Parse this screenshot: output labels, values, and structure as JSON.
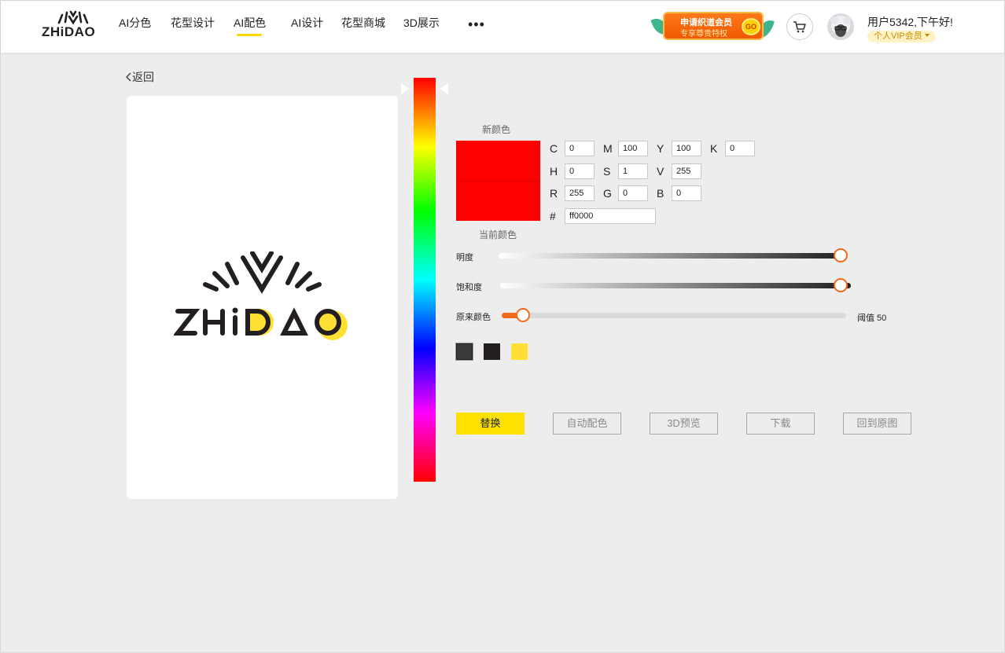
{
  "header": {
    "logo_text": "ZHiDAO",
    "nav": [
      {
        "label": "AI分色",
        "name": "nav-ai-separation"
      },
      {
        "label": "花型设计",
        "name": "nav-pattern-design"
      },
      {
        "label": "AI配色",
        "name": "nav-ai-coloring",
        "active": true
      },
      {
        "label": "AI设计",
        "name": "nav-ai-design"
      },
      {
        "label": "花型商城",
        "name": "nav-pattern-mall"
      },
      {
        "label": "3D展示",
        "name": "nav-3d-display"
      }
    ],
    "more_label": "•••",
    "vip_banner": {
      "line1": "申请织道会员",
      "line2": "专享尊贵特权",
      "go": "GO"
    },
    "greeting": "用户5342,下午好!",
    "member_badge": "个人VIP会员"
  },
  "back_label": "返回",
  "color_panel": {
    "new_color_label": "新颜色",
    "current_color_label": "当前颜色",
    "new_color": "#ff0000",
    "current_color": "#ff0000",
    "fields": {
      "C": "0",
      "M": "100",
      "Y": "100",
      "K": "0",
      "H": "0",
      "S": "1",
      "V": "255",
      "R": "255",
      "G": "0",
      "B": "0",
      "hex": "ff0000"
    },
    "field_labels": {
      "C": "C",
      "M": "M",
      "Y": "Y",
      "K": "K",
      "H": "H",
      "S": "S",
      "V": "V",
      "R": "R",
      "G": "G",
      "B": "B",
      "hex": "#"
    }
  },
  "sliders": {
    "brightness": {
      "label": "明度",
      "value": 1.0
    },
    "saturation": {
      "label": "饱和度",
      "value": 1.0
    },
    "original": {
      "label": "原来颜色",
      "value": 0.06,
      "threshold_text": "阈值 50"
    }
  },
  "palette": [
    {
      "color": "#3a3a3a",
      "selected": true
    },
    {
      "color": "#231f20",
      "selected": false
    },
    {
      "color": "#ffe033",
      "selected": false
    }
  ],
  "buttons": {
    "replace": "替换",
    "auto_color": "自动配色",
    "preview_3d": "3D预览",
    "download": "下载",
    "restore": "回到原图"
  },
  "colors": {
    "accent": "#ffe100",
    "slider_accent": "#f06a1a",
    "logo_dark": "#231f20",
    "logo_yellow": "#ffe033"
  }
}
